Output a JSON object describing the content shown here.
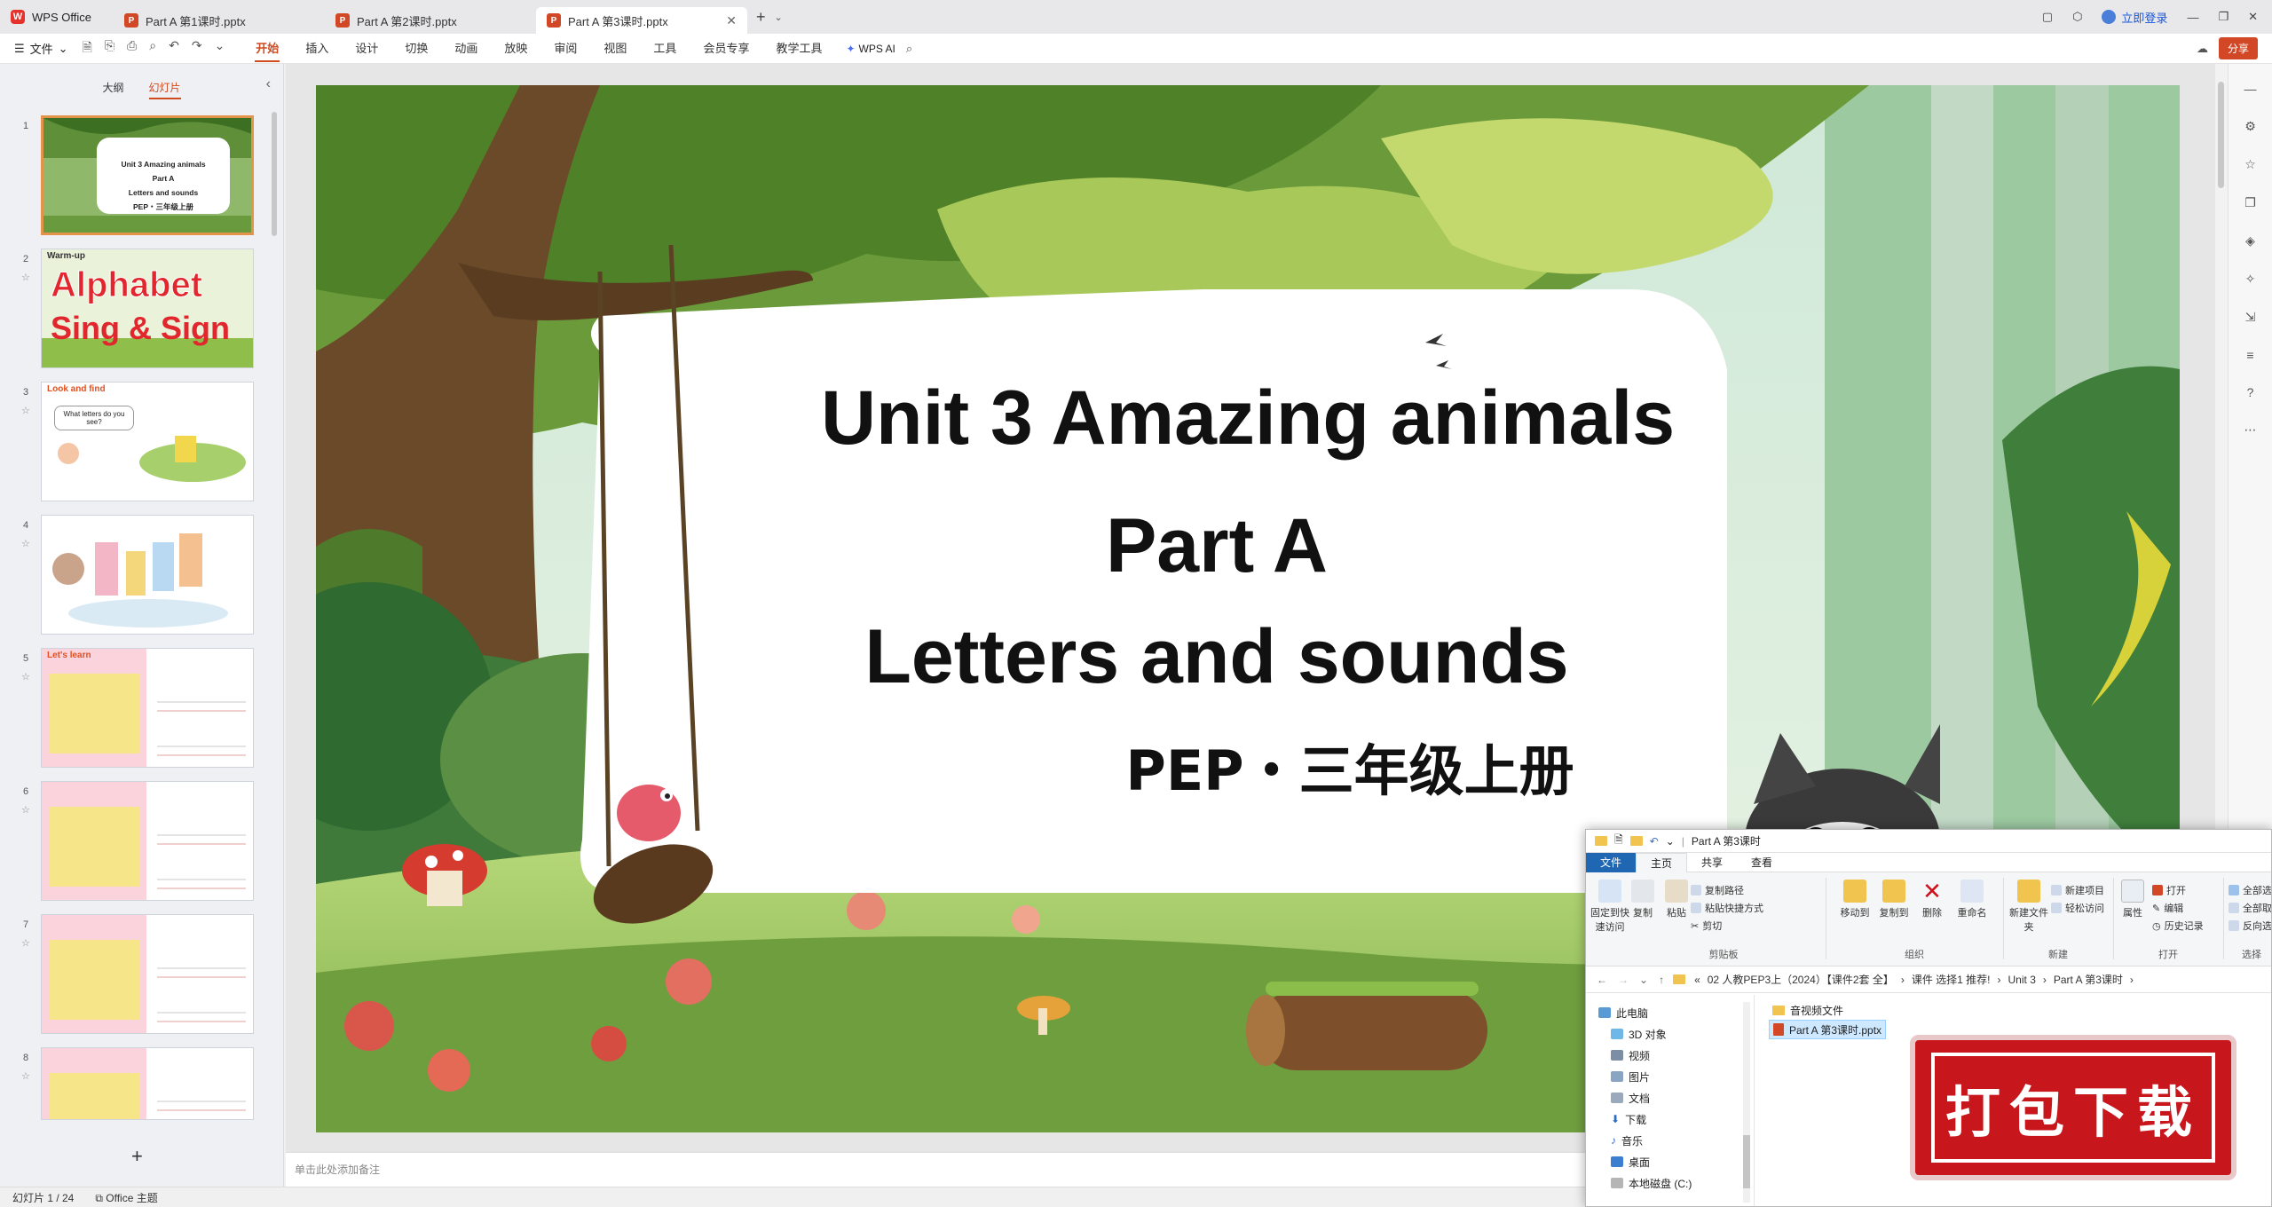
{
  "tabbar": {
    "app_label": "WPS Office",
    "tabs": [
      {
        "label": "Part A 第1课时.pptx"
      },
      {
        "label": "Part A 第2课时.pptx"
      },
      {
        "label": "Part A 第3课时.pptx"
      }
    ],
    "login_label": "立即登录"
  },
  "ribbon": {
    "file_label": "文件",
    "tabs": [
      "开始",
      "插入",
      "设计",
      "切换",
      "动画",
      "放映",
      "审阅",
      "视图",
      "工具",
      "会员专享",
      "教学工具"
    ],
    "wps_ai_label": "WPS AI",
    "share_label": "分享"
  },
  "left_panel": {
    "tab_outline": "大纲",
    "tab_slides": "幻灯片",
    "slides": [
      {
        "num": "1",
        "lines": [
          "Unit 3 Amazing animals",
          "Part A",
          "Letters and sounds",
          "PEP・三年级上册"
        ]
      },
      {
        "num": "2",
        "label": "Warm-up",
        "big1": "Alphabet",
        "big2": "Sing & Sign"
      },
      {
        "num": "3",
        "label": "Look and find",
        "bubble": "What letters do you see?"
      },
      {
        "num": "4"
      },
      {
        "num": "5",
        "label": "Let's learn"
      },
      {
        "num": "6"
      },
      {
        "num": "7"
      },
      {
        "num": "8"
      }
    ],
    "add_label": "+"
  },
  "slide": {
    "title": "Unit 3 Amazing animals",
    "part": "Part A",
    "subtitle": "Letters and sounds",
    "footer": "PEP・三年级上册"
  },
  "notes_placeholder": "单击此处添加备注",
  "statusbar": {
    "slide_count": "幻灯片 1 / 24",
    "theme": "Office 主题"
  },
  "explorer": {
    "title": "Part A 第3课时",
    "tabs": [
      "文件",
      "主页",
      "共享",
      "查看"
    ],
    "groups": {
      "clipboard": "剪贴板",
      "organize": "组织",
      "new": "新建",
      "open": "打开",
      "select": "选择"
    },
    "buttons": {
      "pin": "固定到快速访问",
      "copy": "复制",
      "paste": "粘贴",
      "copy_path": "复制路径",
      "paste_shortcut": "粘贴快捷方式",
      "cut": "剪切",
      "move_to": "移动到",
      "copy_to": "复制到",
      "delete": "删除",
      "rename": "重命名",
      "new_folder": "新建文件夹",
      "new_item": "新建项目",
      "easy_access": "轻松访问",
      "properties": "属性",
      "open": "打开",
      "edit": "编辑",
      "history": "历史记录",
      "select_all": "全部选择",
      "select_none": "全部取消",
      "invert": "反向选择"
    },
    "path": [
      "02 人教PEP3上（2024）【课件2套 全】",
      "课件 选择1 推荐!",
      "Unit 3",
      "Part A 第3课时"
    ],
    "tree": [
      "此电脑",
      "3D 对象",
      "视频",
      "图片",
      "文档",
      "下载",
      "音乐",
      "桌面",
      "本地磁盘 (C:)"
    ],
    "files": [
      {
        "name": "音视频文件",
        "type": "folder"
      },
      {
        "name": "Part A 第3课时.pptx",
        "type": "pptx"
      }
    ]
  },
  "stamp_label": "打包下载",
  "colors": {
    "accent": "#d04a20",
    "ppt_red": "#d24726",
    "stamp_red": "#c8161d",
    "explorer_blue": "#1f66b3"
  }
}
